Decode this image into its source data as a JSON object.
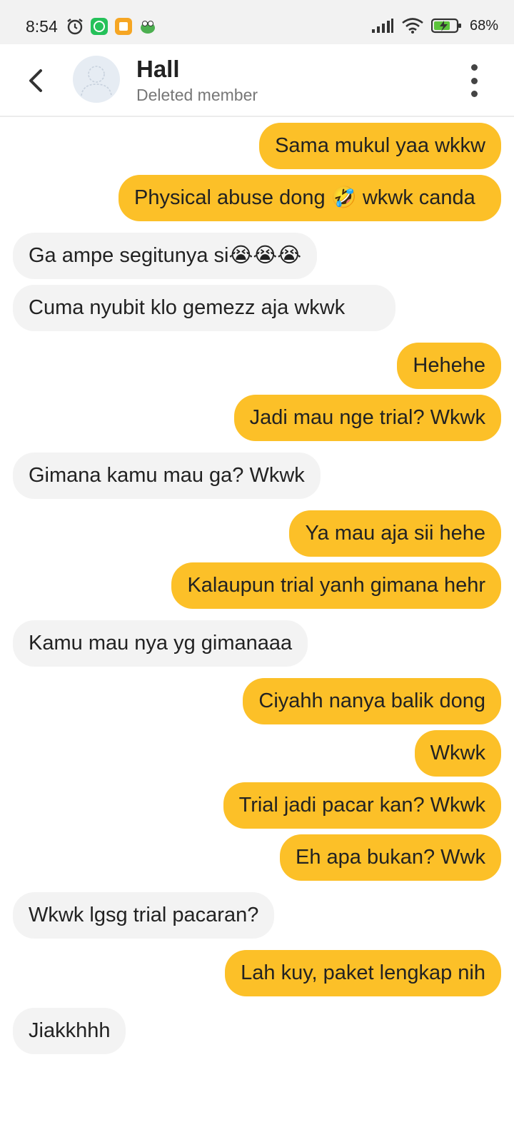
{
  "status_bar": {
    "time": "8:54",
    "battery": "68%",
    "icons_left": [
      "alarm-icon",
      "whatsapp-icon",
      "notes-app-icon",
      "frog-app-icon"
    ],
    "icons_right": [
      "signal-icon",
      "wifi-icon",
      "battery-icon"
    ]
  },
  "header": {
    "name": "Hall",
    "subtitle": "Deleted member"
  },
  "colors": {
    "outgoing_bubble": "#fcc028",
    "incoming_bubble": "#f3f3f3",
    "background": "#ffffff"
  },
  "messages": [
    {
      "dir": "out",
      "text": "Sama mukul yaa wkkw"
    },
    {
      "dir": "out",
      "text": "Physical abuse dong 🤣 wkwk canda"
    },
    {
      "dir": "in",
      "text": "Ga ampe segitunya si😭😭😭"
    },
    {
      "dir": "in",
      "text": "Cuma nyubit klo gemezz aja wkwk"
    },
    {
      "dir": "out",
      "text": "Hehehe"
    },
    {
      "dir": "out",
      "text": "Jadi mau nge trial? Wkwk"
    },
    {
      "dir": "in",
      "text": "Gimana kamu mau ga? Wkwk"
    },
    {
      "dir": "out",
      "text": "Ya mau aja sii hehe"
    },
    {
      "dir": "out",
      "text": "Kalaupun trial yanh gimana hehr"
    },
    {
      "dir": "in",
      "text": "Kamu mau nya yg gimanaaa"
    },
    {
      "dir": "out",
      "text": "Ciyahh nanya balik dong"
    },
    {
      "dir": "out",
      "text": "Wkwk"
    },
    {
      "dir": "out",
      "text": "Trial jadi pacar kan? Wkwk"
    },
    {
      "dir": "out",
      "text": "Eh apa bukan? Wwk"
    },
    {
      "dir": "in",
      "text": "Wkwk lgsg trial pacaran?"
    },
    {
      "dir": "out",
      "text": "Lah kuy, paket lengkap nih"
    },
    {
      "dir": "in",
      "text": "Jiakkhhh"
    }
  ]
}
